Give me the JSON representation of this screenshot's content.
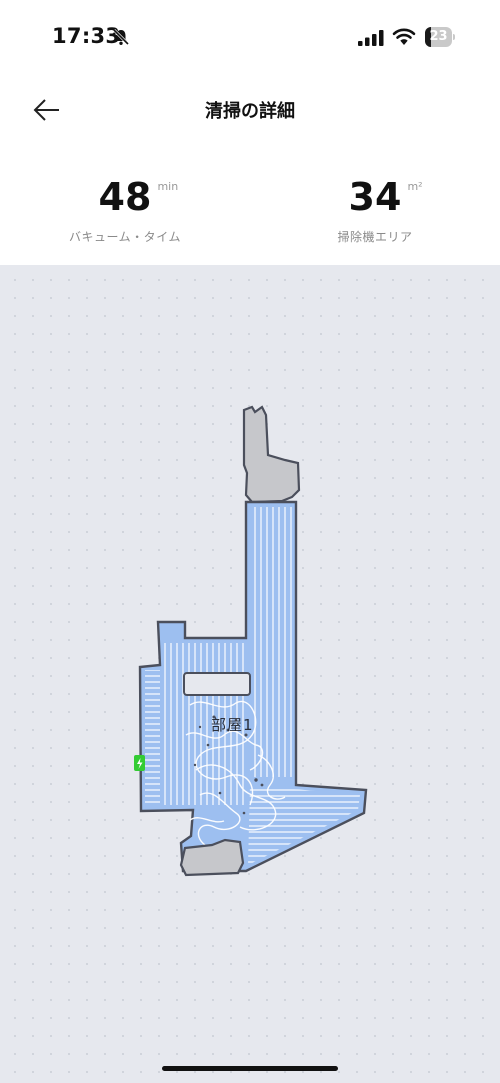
{
  "status_bar": {
    "time": "17:33",
    "battery_level": "23",
    "icons": [
      "bell-slash-icon",
      "cellular-signal-icon",
      "wifi-icon",
      "battery-icon"
    ]
  },
  "header": {
    "title": "清掃の詳細",
    "back_icon": "arrow-left-icon"
  },
  "stats": {
    "vacuum_time": {
      "value": "48",
      "unit": "min",
      "label": "バキューム・タイム"
    },
    "cleaned_area": {
      "value": "34",
      "unit": "m²",
      "label": "掃除機エリア"
    }
  },
  "map": {
    "room_name": "部屋1",
    "colors": {
      "background": "#e6e8ee",
      "cleaned": "#9dbff0",
      "uncleaned": "#c6c7cb",
      "wall": "#4b4f5c",
      "path": "#ffffff",
      "dock": "#33cc33"
    },
    "icons": [
      "charging-dock-icon"
    ]
  }
}
